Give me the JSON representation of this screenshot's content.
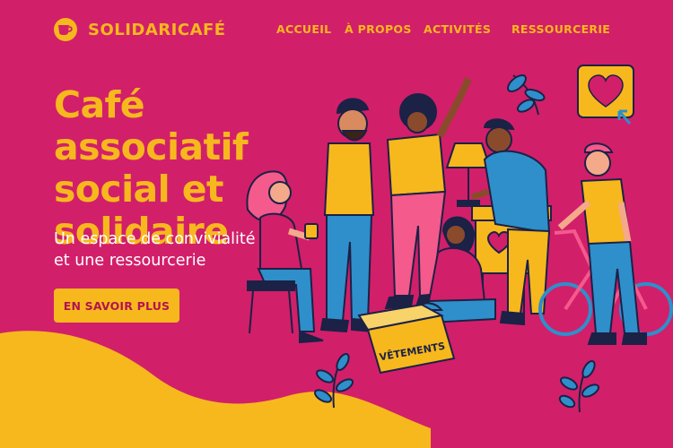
{
  "brand": {
    "name": "SOLIDARICAFÉ",
    "logo_icon": "coffee-cup-icon"
  },
  "nav": {
    "items": [
      {
        "label": "ACCUEIL"
      },
      {
        "label": "À PROPOS"
      },
      {
        "label": "ACTIVITÉS"
      },
      {
        "label": "RESSOURCERIE"
      }
    ]
  },
  "hero": {
    "headline_lines": [
      "Café associatif",
      "social et",
      "solidaire"
    ],
    "subtitle_lines": [
      "Un espace de convivialité",
      "et une ressourcerie"
    ],
    "cta_label": "EN SAVOIR PLUS"
  },
  "illustration": {
    "box_label": "VÊTEMENTS"
  },
  "colors": {
    "background": "#D21F6A",
    "accent": "#F7B81D",
    "blue": "#2E8FCB",
    "pink": "#F45A8C",
    "navy": "#1C2146"
  }
}
